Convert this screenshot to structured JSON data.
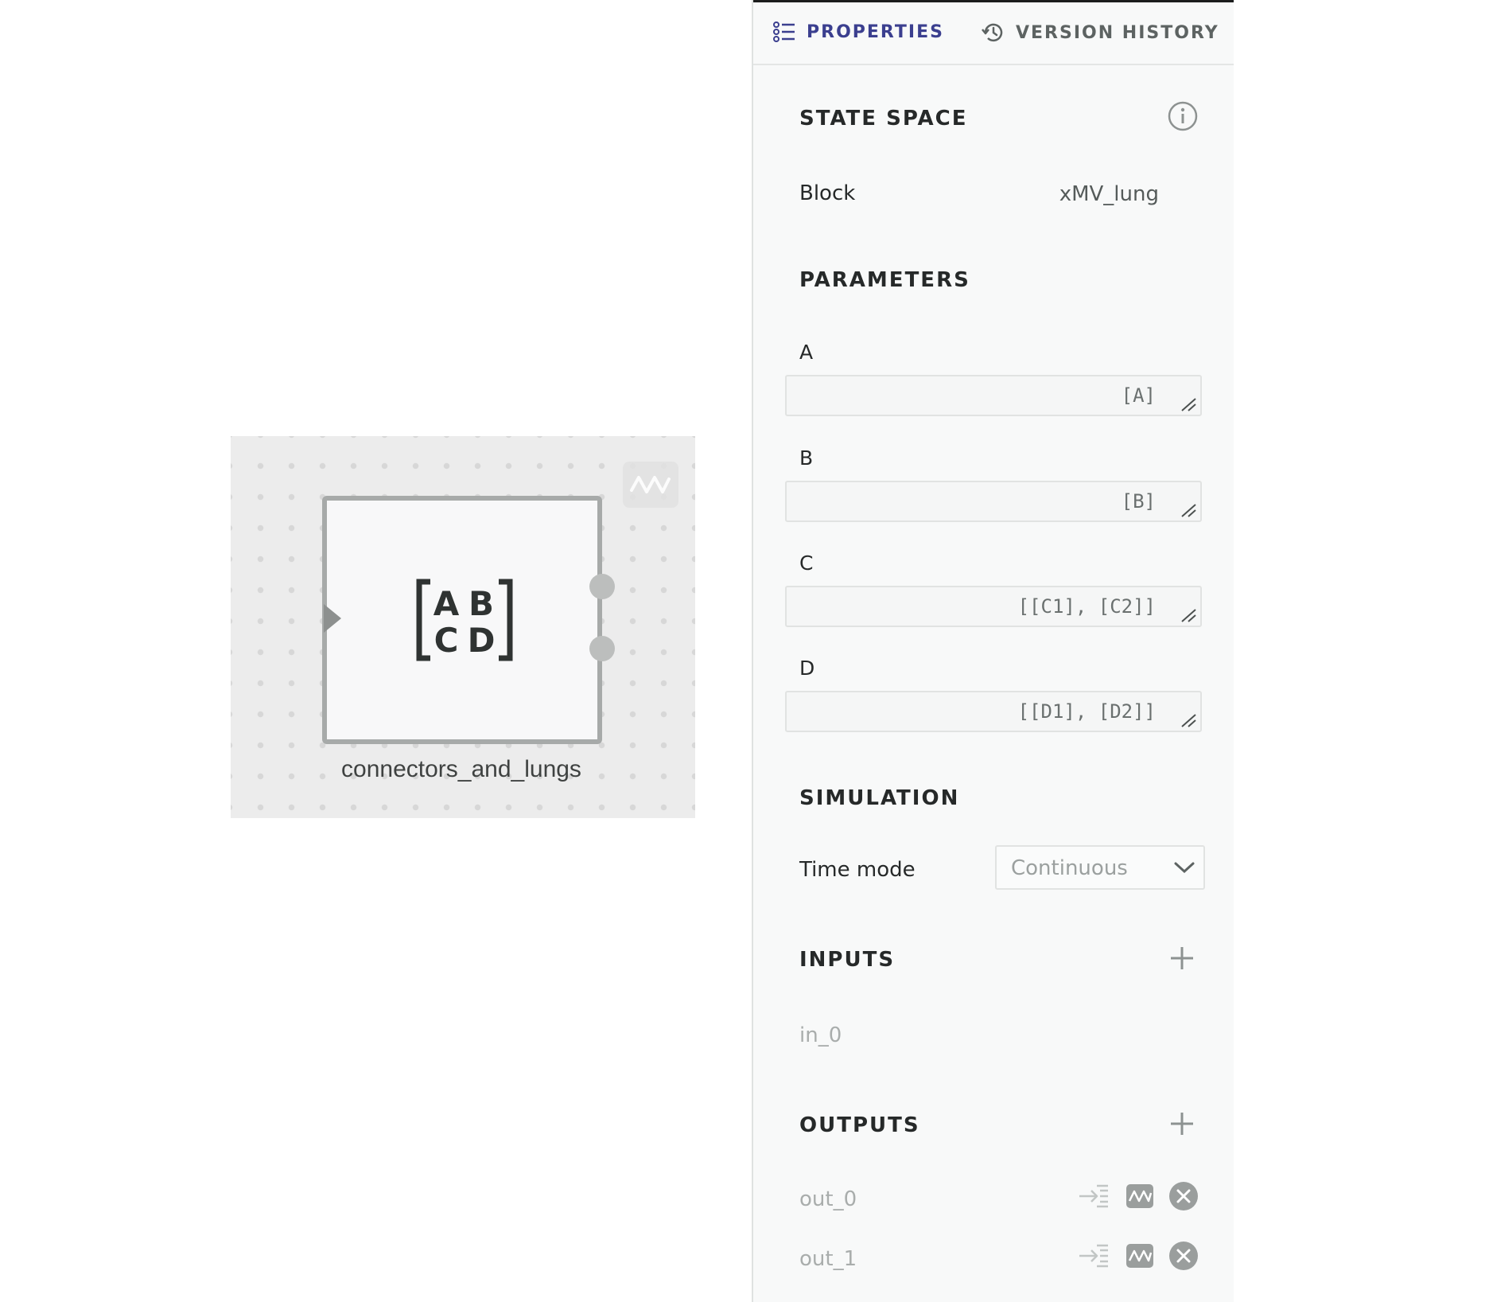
{
  "canvas": {
    "block": {
      "label": "connectors_and_lungs",
      "matrix_letters": [
        "A",
        "B",
        "C",
        "D"
      ],
      "icon": "state-space-matrix-icon"
    },
    "plot_toggle_icon": "waveform-icon"
  },
  "panel": {
    "tabs": [
      {
        "label": "PROPERTIES",
        "icon": "list-icon",
        "active": true
      },
      {
        "label": "VERSION HISTORY",
        "icon": "history-icon",
        "active": false
      }
    ],
    "state_space": {
      "title": "STATE SPACE",
      "block_label": "Block",
      "block_value": "xMV_lung",
      "info_icon": "info-icon"
    },
    "parameters": {
      "title": "PARAMETERS",
      "items": [
        {
          "label": "A",
          "value": "[A]"
        },
        {
          "label": "B",
          "value": "[B]"
        },
        {
          "label": "C",
          "value": "[[C1], [C2]]"
        },
        {
          "label": "D",
          "value": "[[D1], [D2]]"
        }
      ]
    },
    "simulation": {
      "title": "SIMULATION",
      "time_mode_label": "Time mode",
      "time_mode_value": "Continuous"
    },
    "inputs": {
      "title": "INPUTS",
      "items": [
        "in_0"
      ]
    },
    "outputs": {
      "title": "OUTPUTS",
      "items": [
        "out_0",
        "out_1"
      ]
    },
    "colors": {
      "accent": "#3b3f8f",
      "text": "#262929",
      "muted": "#a9adac"
    }
  }
}
